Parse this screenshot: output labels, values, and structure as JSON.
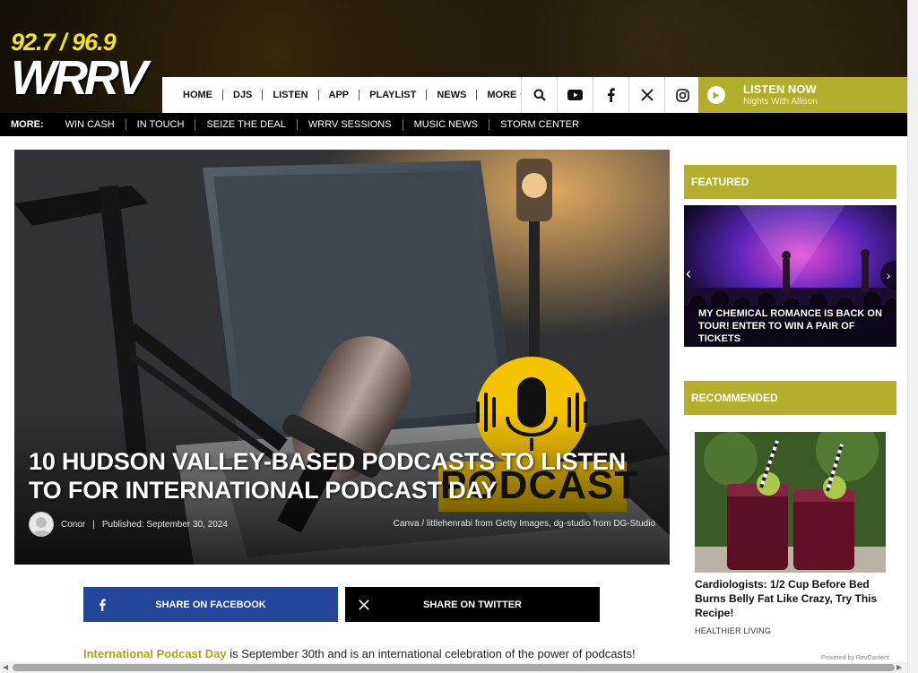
{
  "header": {
    "logo_frequency": "92.7 / 96.9",
    "logo_callsign": "WRRV",
    "nav": [
      {
        "label": "HOME"
      },
      {
        "label": "DJS"
      },
      {
        "label": "LISTEN"
      },
      {
        "label": "APP"
      },
      {
        "label": "PLAYLIST"
      },
      {
        "label": "NEWS"
      },
      {
        "label": "MORE"
      }
    ],
    "icons": [
      "search-icon",
      "youtube-icon",
      "facebook-icon",
      "x-icon",
      "instagram-icon"
    ],
    "listen": {
      "title": "LISTEN NOW",
      "subtitle": "Nights With Allison"
    }
  },
  "morebar": {
    "label": "MORE:",
    "items": [
      "WIN CASH",
      "IN TOUCH",
      "SEIZE THE DEAL",
      "WRRV SESSIONS",
      "MUSIC NEWS",
      "STORM CENTER"
    ]
  },
  "hero": {
    "title": "10 Hudson Valley-Based Podcasts to Listen To for International Podcast Day",
    "author": "Conor",
    "published": "Published: September 30, 2024",
    "credit": "Canva / littlehenrabi from Getty Images, dg-studio from DG-Studio",
    "badge_text": "PODCAST"
  },
  "share": {
    "facebook": "SHARE ON FACEBOOK",
    "twitter": "SHARE ON TWITTER"
  },
  "article": {
    "link_text": "International Podcast Day",
    "rest": " is September 30th and is an international celebration of the power of podcasts!"
  },
  "sidebar": {
    "featured_heading": "FEATURED",
    "featured_caption": "My Chemical Romance Is Back On Tour! Enter To Win A Pair Of Tickets",
    "recommended_heading": "RECOMMENDED",
    "recommended_title": "Cardiologists: 1/2 Cup Before Bed Burns Belly Fat Like Crazy, Try This Recipe!",
    "recommended_source": "HEALTHIER LIVING",
    "powered_by": "Powered by RevContent"
  },
  "colors": {
    "accent": "#b4ae2c",
    "logo_yellow": "#f4e21c",
    "facebook": "#22479a",
    "twitter": "#000000"
  }
}
